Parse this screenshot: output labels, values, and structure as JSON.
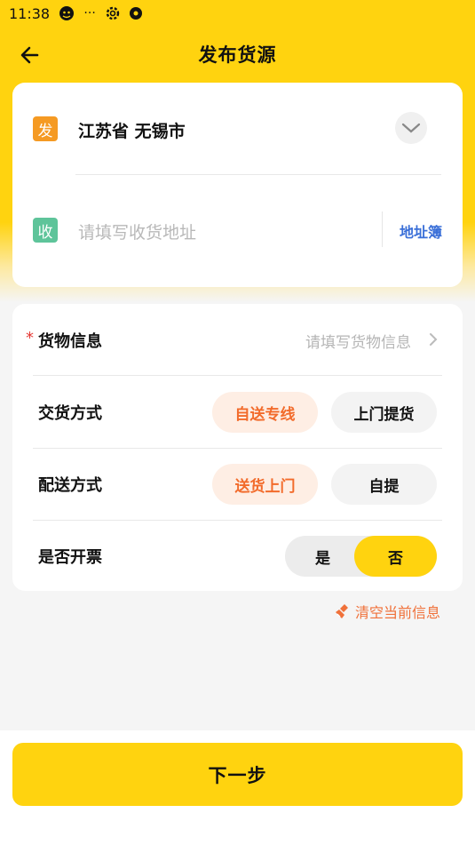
{
  "status_bar": {
    "time": "11:38",
    "dots": "···"
  },
  "header": {
    "title": "发布货源"
  },
  "address": {
    "from_badge": "发",
    "from_value": "江苏省 无锡市",
    "to_badge": "收",
    "to_placeholder": "请填写收货地址",
    "address_book": "地址簿"
  },
  "form": {
    "goods": {
      "required_mark": "*",
      "label": "货物信息",
      "placeholder": "请填写货物信息"
    },
    "delivery_mode": {
      "label": "交货方式",
      "options": [
        "自送专线",
        "上门提货"
      ],
      "selected": "自送专线"
    },
    "shipping_mode": {
      "label": "配送方式",
      "options": [
        "送货上门",
        "自提"
      ],
      "selected": "送货上门"
    },
    "invoice": {
      "label": "是否开票",
      "options": [
        "是",
        "否"
      ],
      "selected": "否"
    }
  },
  "clear_label": "清空当前信息",
  "next_label": "下一步",
  "colors": {
    "brand": "#ffd30f",
    "accent_orange": "#f26b2b",
    "link_blue": "#3a6fd8",
    "from_badge": "#f59a23",
    "to_badge": "#5ec49a"
  }
}
